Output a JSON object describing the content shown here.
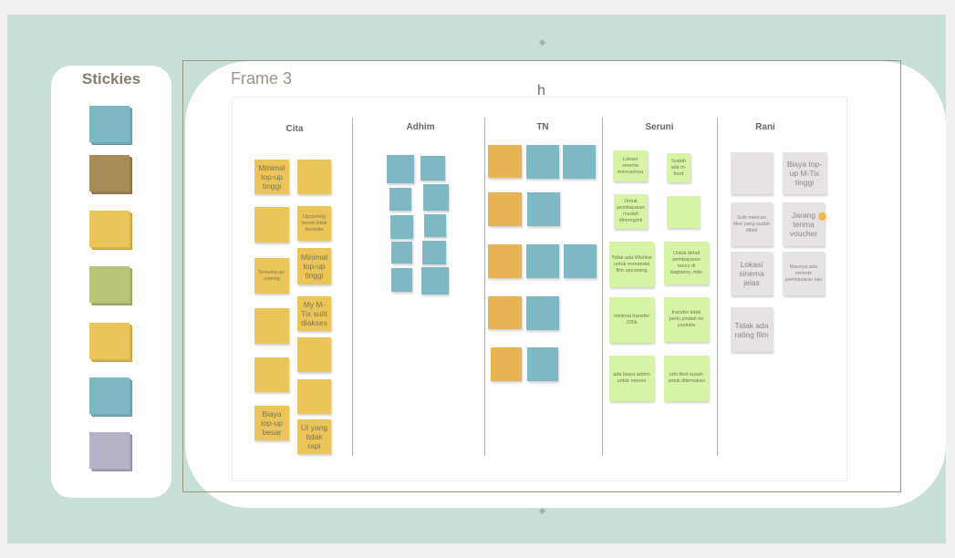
{
  "sidebar": {
    "title": "Stickies",
    "swatches": [
      {
        "name": "blue",
        "color": "#7fb8c5"
      },
      {
        "name": "brown",
        "color": "#a88b57"
      },
      {
        "name": "yellow",
        "color": "#ecc55a"
      },
      {
        "name": "green",
        "color": "#b7c679"
      },
      {
        "name": "yellow-2",
        "color": "#ecc55a"
      },
      {
        "name": "blue-2",
        "color": "#7fb8c5"
      },
      {
        "name": "lavender",
        "color": "#b6b3c9"
      }
    ]
  },
  "frame": {
    "title": "Frame 3",
    "subtitle": "h"
  },
  "columns": {
    "cita": "Cita",
    "adhim": "Adhim",
    "tn": "TN",
    "seruni": "Seruni",
    "rani": "Rani"
  },
  "notes": {
    "cita": {
      "n1": "Minimal top-up tinggi",
      "n2": "",
      "n3": "",
      "n4": "Upcoming movie tidak tersedia",
      "n5": "Tersedia up-coming",
      "n6": "Minimal top-up tinggi",
      "n7": "",
      "n8": "My M-Tix sulit diakses",
      "n9": "",
      "n10": "",
      "n11": "Biaya top-up besar",
      "n12": "UI yang tidak rapi"
    },
    "seruni": {
      "n1": "Lokasi sinema mencarinya",
      "n2": "Sudah ada m-food",
      "n3": "Untuk pembayaran mudah dimengerti",
      "n4": "",
      "n5": "Tidak ada Wishlist untuk menandai film upcoming",
      "n6": "Untuk detail pembayaran rancu di bagianny..mtix",
      "n7": "minimal transfer 100k",
      "n8": "transfer tidak perlu pindah ke youtube",
      "n9": "ada biaya admin untuk menon",
      "n10": "info tiket susah untuk ditemukan"
    },
    "rani": {
      "n1": "",
      "n2": "Biaya top-up M-Tix tinggi",
      "n3": "Sulit mencari tiket yang sudah dibeli",
      "n4": "Jarang terima voucher",
      "n5": "Lokasi sinema jelas",
      "n6": "Maunya ada metode pembayaran lain",
      "n7": "Tidak ada rating film"
    }
  }
}
